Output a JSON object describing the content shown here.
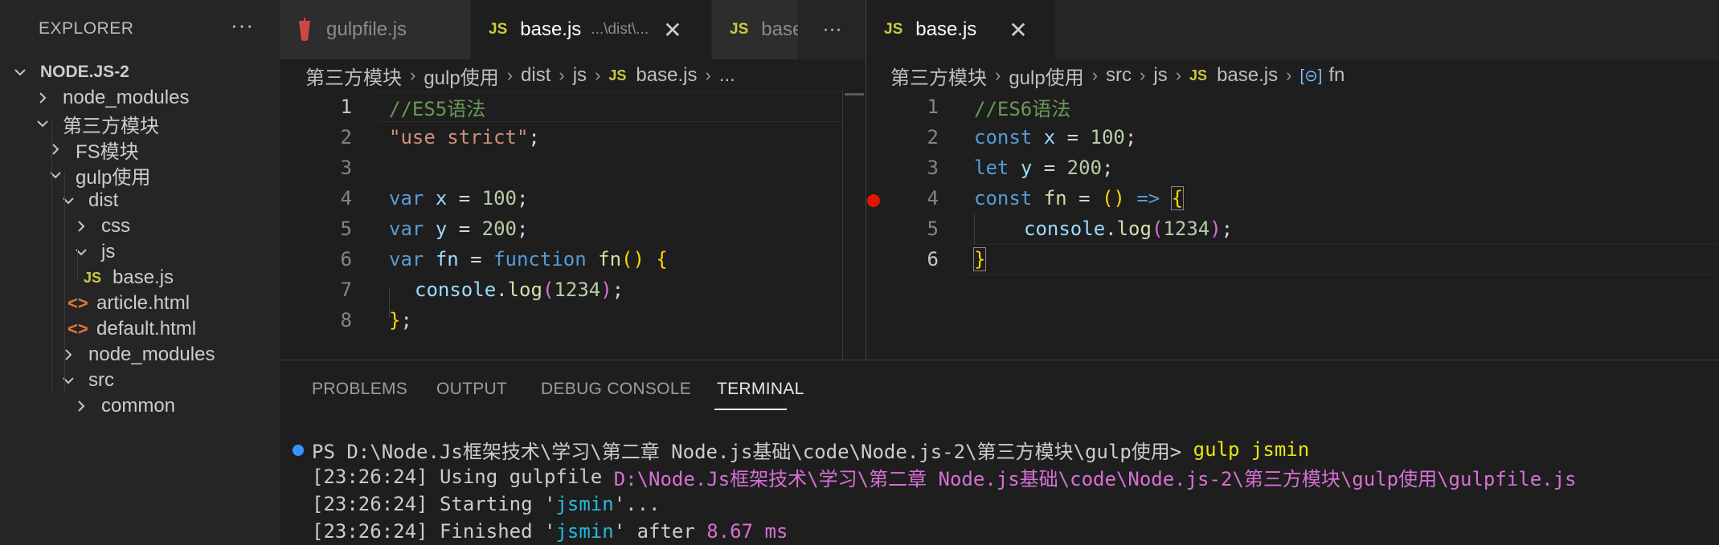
{
  "sidebar": {
    "title": "EXPLORER",
    "more": "···",
    "tree": [
      {
        "label": "NODE.JS-2",
        "kind": "root"
      },
      {
        "label": "node_modules",
        "kind": "folder-collapsed"
      },
      {
        "label": "第三方模块",
        "kind": "folder-open"
      },
      {
        "label": "FS模块",
        "kind": "folder-collapsed"
      },
      {
        "label": "gulp使用",
        "kind": "folder-open"
      },
      {
        "label": "dist",
        "kind": "folder-open"
      },
      {
        "label": "css",
        "kind": "folder-collapsed"
      },
      {
        "label": "js",
        "kind": "folder-open"
      },
      {
        "label": "base.js",
        "kind": "file-js",
        "icon": "JS"
      },
      {
        "label": "article.html",
        "kind": "file-html",
        "icon": "<>"
      },
      {
        "label": "default.html",
        "kind": "file-html",
        "icon": "<>"
      },
      {
        "label": "node_modules",
        "kind": "folder-collapsed"
      },
      {
        "label": "src",
        "kind": "folder-open"
      },
      {
        "label": "common",
        "kind": "folder-collapsed"
      }
    ]
  },
  "left_editor": {
    "tabs": [
      {
        "label": "gulpfile.js",
        "icon": "gulp-icon"
      },
      {
        "badge": "JS",
        "label": "base.js",
        "desc": "...\\dist\\...",
        "close": "✕"
      },
      {
        "badge": "JS",
        "label": "base.js"
      }
    ],
    "more": "···",
    "breadcrumb": {
      "items": [
        "第三方模块",
        "gulp使用",
        "dist",
        "js"
      ],
      "file_badge": "JS",
      "file": "base.js",
      "tail": "..."
    },
    "line_numbers": [
      "1",
      "2",
      "3",
      "4",
      "5",
      "6",
      "7",
      "8"
    ]
  },
  "right_editor": {
    "tab": {
      "badge": "JS",
      "label": "base.js",
      "close": "✕"
    },
    "breadcrumb": {
      "items": [
        "第三方模块",
        "gulp使用",
        "src",
        "js"
      ],
      "file_badge": "JS",
      "file": "base.js",
      "symbol_icon": "[⊝]",
      "symbol": "fn"
    },
    "line_numbers": [
      "1",
      "2",
      "3",
      "4",
      "5",
      "6"
    ],
    "breakpoint_line": 4
  },
  "panel": {
    "tabs": [
      "PROBLEMS",
      "OUTPUT",
      "DEBUG CONSOLE",
      "TERMINAL"
    ],
    "active_tab": "TERMINAL",
    "terminal": {
      "prompt": "PS D:\\Node.Js框架技术\\学习\\第二章 Node.js基础\\code\\Node.js-2\\第三方模块\\gulp使用> ",
      "command": "gulp jsmin",
      "line2_prefix": "[23:26:24] Using gulpfile ",
      "line2_path": "D:\\Node.Js框架技术\\学习\\第二章 Node.js基础\\code\\Node.js-2\\第三方模块\\gulp使用\\gulpfile.js",
      "line3_prefix": "[23:26:24] Starting '",
      "line3_task": "jsmin",
      "line3_suffix": "'...",
      "line4_prefix": "[23:26:24] Finished '",
      "line4_task": "jsmin",
      "line4_mid": "' after ",
      "line4_time": "8.67 ms"
    }
  },
  "colors": {
    "background": "#1e1e1e",
    "sidebar": "#252526",
    "js_badge": "#cbcb41",
    "html_icon": "#e37933",
    "breakpoint": "#e51400",
    "comment": "#6a9955",
    "keyword": "#569cd6"
  }
}
